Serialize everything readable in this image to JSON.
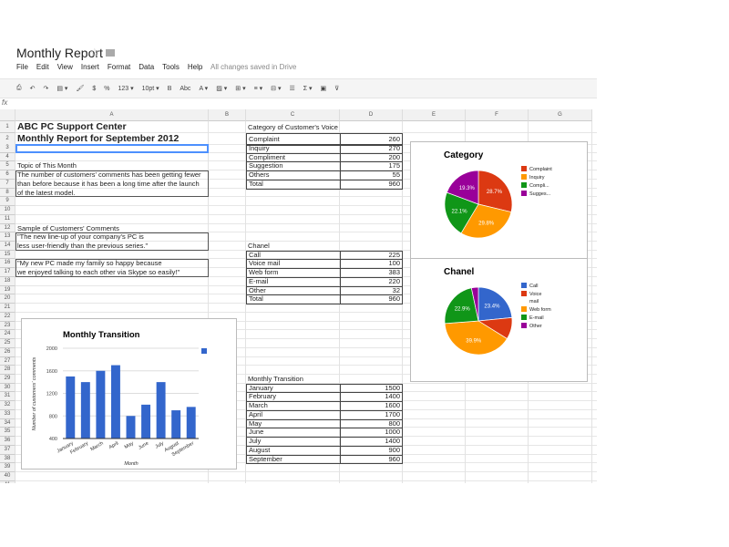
{
  "doc": {
    "title": "Monthly Report",
    "saved": "All changes saved in Drive",
    "star_icon": "star-icon",
    "folder_icon": "folder-icon"
  },
  "menu": [
    "File",
    "Edit",
    "View",
    "Insert",
    "Format",
    "Data",
    "Tools",
    "Help"
  ],
  "toolbar": [
    "⎙",
    "↶",
    "↷",
    "▤ ▾",
    "🖌",
    "$",
    "%",
    "123 ▾",
    "10pt ▾",
    "B",
    "Abc",
    "A ▾",
    "▨ ▾",
    "⊞ ▾",
    "≡ ▾",
    "⊟ ▾",
    "☰",
    "Σ ▾",
    "▣",
    "⊽"
  ],
  "formula_bar": {
    "label": "fx",
    "value": ""
  },
  "columns": [
    "A",
    "B",
    "C",
    "D",
    "E",
    "F",
    "G"
  ],
  "cells": [
    {
      "r": 1,
      "c": 0,
      "v": "ABC PC Support Center",
      "style": "title"
    },
    {
      "r": 2,
      "c": 0,
      "v": "Monthly Report for September 2012",
      "style": "title"
    },
    {
      "r": 5,
      "c": 0,
      "v": "Topic of This Month"
    },
    {
      "r": 6,
      "c": 0,
      "v": "The number of customers' comments has been getting fewer"
    },
    {
      "r": 7,
      "c": 0,
      "v": "than before because it has been a long time after the launch"
    },
    {
      "r": 8,
      "c": 0,
      "v": "of the latest model."
    },
    {
      "r": 12,
      "c": 0,
      "v": "Sample of Customers' Comments"
    },
    {
      "r": 13,
      "c": 0,
      "v": "\"The new line-up of your company's PC is"
    },
    {
      "r": 14,
      "c": 0,
      "v": "less user-friendly than the previous series.\""
    },
    {
      "r": 16,
      "c": 0,
      "v": "\"My new PC made my family so happy because"
    },
    {
      "r": 17,
      "c": 0,
      "v": "we enjoyed talking to each other via Skype so easily!\""
    },
    {
      "r": 1,
      "c": 2,
      "v": "Category of Customer's Voice"
    },
    {
      "r": 14,
      "c": 2,
      "v": "Chanel"
    },
    {
      "r": 29,
      "c": 2,
      "v": "Monthly Transition"
    }
  ],
  "tables": [
    {
      "start_row": 2,
      "rows": [
        [
          "Complaint",
          "260"
        ],
        [
          "Inquiry",
          "270"
        ],
        [
          "Compliment",
          "200"
        ],
        [
          "Suggestion",
          "175"
        ],
        [
          "Others",
          "55"
        ],
        [
          "Total",
          "960"
        ]
      ]
    },
    {
      "start_row": 15,
      "rows": [
        [
          "Call",
          "225"
        ],
        [
          "Voice mail",
          "100"
        ],
        [
          "Web form",
          "383"
        ],
        [
          "E-mail",
          "220"
        ],
        [
          "Other",
          "32"
        ],
        [
          "Total",
          "960"
        ]
      ]
    },
    {
      "start_row": 30,
      "rows": [
        [
          "January",
          "1500"
        ],
        [
          "February",
          "1400"
        ],
        [
          "March",
          "1600"
        ],
        [
          "April",
          "1700"
        ],
        [
          "May",
          "800"
        ],
        [
          "June",
          "1000"
        ],
        [
          "July",
          "1400"
        ],
        [
          "August",
          "900"
        ],
        [
          "September",
          "960"
        ]
      ]
    }
  ],
  "chart_data": [
    {
      "type": "pie",
      "title": "Category",
      "categories": [
        "Complaint",
        "Inquiry",
        "Compliment",
        "Suggestion"
      ],
      "legend": [
        "Complaint",
        "Inquiry",
        "Compli...",
        "Sugges..."
      ],
      "values": [
        260,
        270,
        200,
        175
      ],
      "labels": [
        "28.7%",
        "29.8%",
        "22.1%",
        "19.3%"
      ],
      "colors": [
        "#dc3912",
        "#ff9900",
        "#109618",
        "#990099"
      ],
      "legend_position": "right"
    },
    {
      "type": "pie",
      "title": "Chanel",
      "categories": [
        "Call",
        "Voice mail",
        "Web form",
        "E-mail",
        "Other"
      ],
      "legend": [
        "Call",
        "Voice mail",
        "Web form",
        "E-mail",
        "Other"
      ],
      "values": [
        225,
        100,
        383,
        220,
        32
      ],
      "labels": [
        "23.4%",
        "",
        "39.9%",
        "22.9%",
        ""
      ],
      "colors": [
        "#3366cc",
        "#dc3912",
        "#ff9900",
        "#109618",
        "#990099"
      ],
      "legend_position": "right"
    },
    {
      "type": "bar",
      "title": "Monthly Transition",
      "categories": [
        "January",
        "February",
        "March",
        "April",
        "May",
        "June",
        "July",
        "August",
        "September"
      ],
      "values": [
        1500,
        1400,
        1600,
        1700,
        800,
        1000,
        1400,
        900,
        960
      ],
      "xlabel": "Month",
      "ylabel": "Number of customers' comments",
      "ylim": [
        400,
        2000
      ],
      "yticks": [
        "400",
        "800",
        "1200",
        "1600",
        "2000"
      ],
      "color": "#3366cc",
      "grid": true,
      "legend_position": "right"
    }
  ]
}
